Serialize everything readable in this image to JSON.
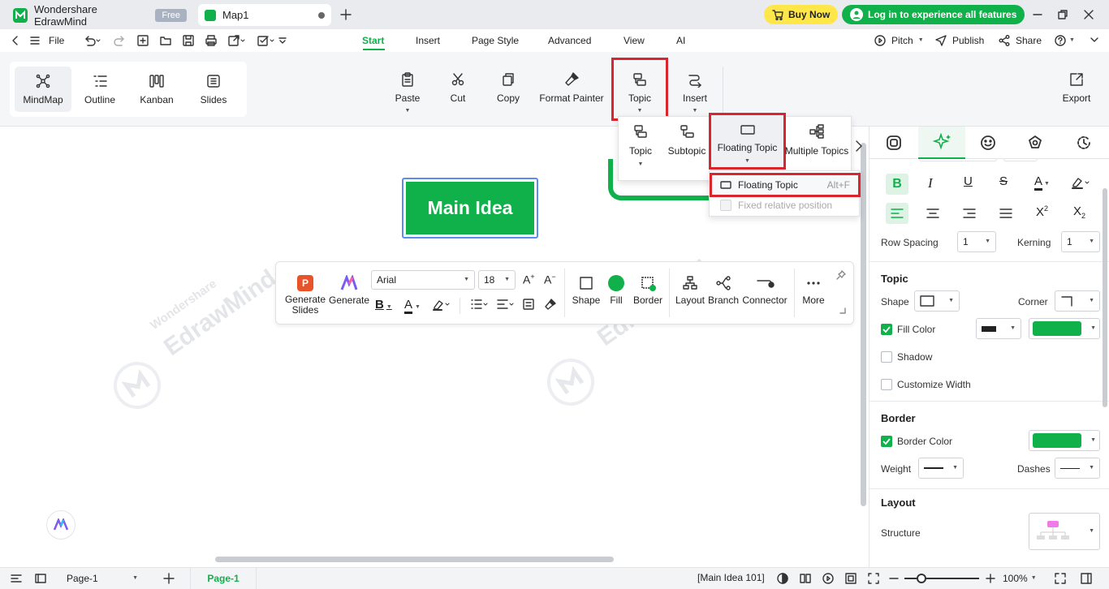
{
  "titlebar": {
    "app_name": "Wondershare EdrawMind",
    "free_badge": "Free",
    "doc_tab": "Map1",
    "buy_now": "Buy Now",
    "login": "Log in to experience all features"
  },
  "menubar": {
    "file": "File",
    "tabs": [
      "Start",
      "Insert",
      "Page Style",
      "Advanced",
      "View",
      "AI"
    ],
    "pitch": "Pitch",
    "publish": "Publish",
    "share": "Share"
  },
  "ribbon": {
    "views": [
      "MindMap",
      "Outline",
      "Kanban",
      "Slides"
    ],
    "paste": "Paste",
    "cut": "Cut",
    "copy": "Copy",
    "format_painter": "Format Painter",
    "topic": "Topic",
    "insert": "Insert",
    "export": "Export"
  },
  "popup": {
    "topic": "Topic",
    "subtopic": "Subtopic",
    "floating_topic": "Floating Topic",
    "multiple_topics": "Multiple Topics",
    "menu_item": "Floating Topic",
    "menu_shortcut": "Alt+F",
    "menu_item_disabled": "Fixed relative position"
  },
  "canvas": {
    "main_idea": "Main Idea",
    "watermark_brand": "Wondershare",
    "watermark_name": "EdrawMind"
  },
  "floatbar": {
    "generate_slides": "Generate Slides",
    "generate": "Generate",
    "font": "Arial",
    "size": "18",
    "shape": "Shape",
    "fill": "Fill",
    "border": "Border",
    "layout": "Layout",
    "branch": "Branch",
    "connector": "Connector",
    "more": "More"
  },
  "panel": {
    "row_spacing_label": "Row Spacing",
    "row_spacing": "1",
    "kerning_label": "Kerning",
    "kerning": "1",
    "topic_head": "Topic",
    "shape_label": "Shape",
    "corner_label": "Corner",
    "fill_color_label": "Fill Color",
    "shadow_label": "Shadow",
    "custom_width_label": "Customize Width",
    "border_head": "Border",
    "border_color_label": "Border Color",
    "weight_label": "Weight",
    "dashes_label": "Dashes",
    "layout_head": "Layout",
    "structure_label": "Structure"
  },
  "status": {
    "page_select": "Page-1",
    "page_tab": "Page-1",
    "info": "[Main Idea 101]",
    "zoom": "100%"
  },
  "colors": {
    "brand_green": "#10b04a",
    "highlight_red": "#d9262e",
    "buy_yellow": "#ffe74a"
  }
}
